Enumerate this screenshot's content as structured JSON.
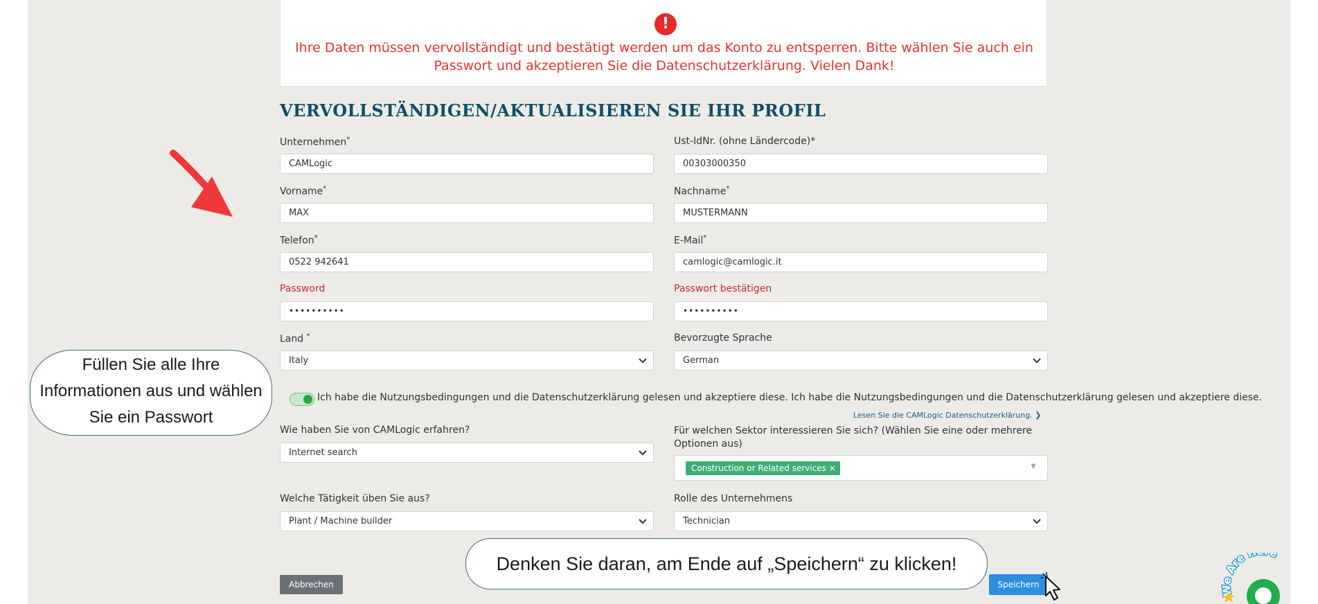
{
  "alert": {
    "icon": "exclamation-icon",
    "message": "Ihre Daten müssen vervollständigt und bestätigt werden um das Konto zu entsperren. Bitte wählen Sie auch ein Passwort und akzeptieren Sie die Datenschutzerklärung. Vielen Dank!"
  },
  "form": {
    "title": "VERVOLLSTÄNDIGEN/AKTUALISIEREN SIE IHR PROFIL",
    "company_label": "Unternehmen",
    "company_value": "CAMLogic",
    "vat_label": "Ust-IdNr. (ohne Ländercode)*",
    "vat_value": "00303000350",
    "firstname_label": "Vorname",
    "firstname_value": "MAX",
    "lastname_label": "Nachname",
    "lastname_value": "MUSTERMANN",
    "phone_label": "Telefon",
    "phone_value": "0522 942641",
    "email_label": "E-Mail",
    "email_value": "camlogic@camlogic.it",
    "password_label": "Password",
    "password_value": "••••••••••",
    "password_confirm_label": "Passwort bestätigen",
    "password_confirm_value": "••••••••••",
    "country_label": "Land",
    "country_value": "Italy",
    "language_label": "Bevorzugte Sprache",
    "language_value": "German",
    "required_mark": "*",
    "terms_text": "Ich habe die Nutzungsbedingungen und die Datenschutzerklärung gelesen und akzeptiere diese. Ich habe die Nutzungsbedingungen und die Datenschutzerklärung gelesen und akzeptiere diese.",
    "terms_checked": true,
    "privacy_link": "Lesen Sie die CAMLogic Datenschutzerklärung. ❯",
    "source_label": "Wie haben Sie von CAMLogic erfahren?",
    "source_value": "Internet search",
    "sector_label": "Für welchen Sektor interessieren Sie sich? (Wählen Sie eine oder mehrere Optionen aus)",
    "sector_tag": "Construction or Related services",
    "sector_tag_remove": "×",
    "activity_label": "Welche Tätigkeit üben Sie aus?",
    "activity_value": "Plant / Machine builder",
    "role_label": "Rolle des Unternehmens",
    "role_value": "Technician",
    "cancel_button": "Abbrechen",
    "save_button": "Speichern"
  },
  "annotations": {
    "left_bubble": "Füllen Sie alle Ihre Informationen aus und wählen Sie ein Passwort",
    "bottom_bubble": "Denken Sie daran, am Ende auf „Speichern“ zu klicken!",
    "chat_badge": "We Are Here"
  },
  "colors": {
    "alert_red": "#e2342b",
    "title_teal": "#0f4f6a",
    "toggle_green": "#27a745",
    "tag_green": "#3fae74",
    "save_blue": "#2d8ee0",
    "cancel_grey": "#6b7177",
    "arrow_red": "#f0383a"
  },
  "icons": {
    "select_chevron": "⌄",
    "caret": "▼"
  }
}
